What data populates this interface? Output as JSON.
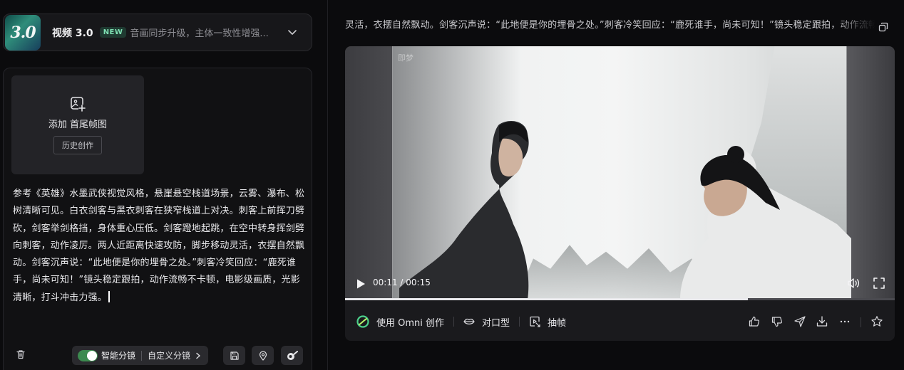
{
  "model": {
    "logo_text": "3.0",
    "name": "视频 3.0",
    "badge": "NEW",
    "description": "音画同步升级，主体一致性增强..."
  },
  "frame_upload": {
    "label": "添加 首尾帧图",
    "history_button": "历史创作"
  },
  "prompt_text": "参考《英雄》水墨武侠视觉风格，悬崖悬空栈道场景，云雾、瀑布、松树清晰可见。白衣剑客与黑衣刺客在狭窄栈道上对决。刺客上前挥刀劈砍，剑客举剑格挡，身体重心压低。剑客蹬地起跳，在空中转身挥剑劈向刺客，动作凌厉。两人近距离快速攻防，脚步移动灵活，衣摆自然飘动。剑客沉声说：“此地便是你的埋骨之处。”刺客冷笑回应：“鹿死谁手，尚未可知！”镜头稳定跟拍，动作流畅不卡顿，电影级画质，光影清晰，打斗冲击力强。",
  "toolbar": {
    "smart_shot_label": "智能分镜",
    "smart_shot_enabled": true,
    "custom_shot_label": "自定义分镜"
  },
  "preview": {
    "prompt_excerpt": "灵活，衣摆自然飘动。剑客沉声说：“此地便是你的埋骨之处。”刺客冷笑回应：“鹿死谁手，尚未可知！”镜头稳定跟拍，动作流畅不卡顿，电影级画质",
    "watermark": "即梦",
    "time_display": "00:11 / 00:15",
    "progress_fraction": 0.733
  },
  "actions": {
    "omni": "使用 Omni 创作",
    "lip_sync": "对口型",
    "extract_frame": "抽帧"
  },
  "colors": {
    "accent_green": "#3c8a4f",
    "badge_green": "#7ee0b3",
    "background": "#0b0b0d"
  }
}
